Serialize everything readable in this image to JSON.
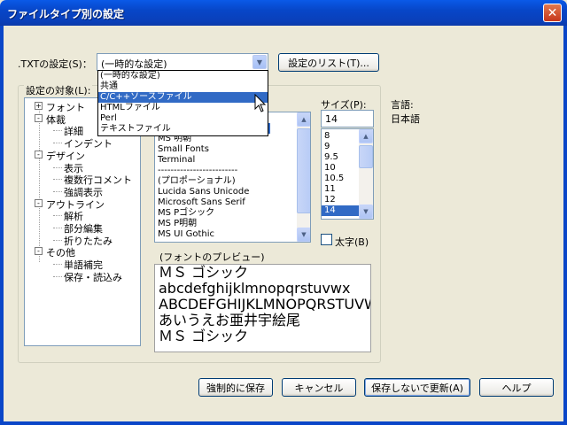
{
  "window": {
    "title": "ファイルタイプ別の設定",
    "close_label": "✕"
  },
  "settings_of": {
    "label": ".TXTの設定(S)：",
    "selected": "(一時的な設定)",
    "list_button": "設定のリスト(T)...",
    "options": [
      "(一時的な設定)",
      "共通",
      "C/C++ソースファイル",
      "HTMLファイル",
      "Perl",
      "テキストファイル"
    ],
    "selected_option": "C/C++ソースファイル"
  },
  "target": {
    "label": "設定の対象(L):",
    "tree": [
      {
        "label": "フォント",
        "toggle": "+"
      },
      {
        "label": "体裁",
        "toggle": "-"
      },
      {
        "label": "詳細"
      },
      {
        "label": "インデント"
      },
      {
        "label": "デザイン",
        "toggle": "-"
      },
      {
        "label": "表示"
      },
      {
        "label": "複数行コメント"
      },
      {
        "label": "強調表示"
      },
      {
        "label": "アウトライン",
        "toggle": "-"
      },
      {
        "label": "解析"
      },
      {
        "label": "部分編集"
      },
      {
        "label": "折りたたみ"
      },
      {
        "label": "その他",
        "toggle": "-"
      },
      {
        "label": "単語補完"
      },
      {
        "label": "保存・読込み"
      }
    ]
  },
  "font_list": {
    "items": [
      "MS 明朝",
      "Small Fonts",
      "Terminal",
      "-------------------------",
      "(プロポーショナル)",
      "Lucida Sans Unicode",
      "Microsoft Sans Serif",
      "MS Pゴシック",
      "MS P明朝",
      "MS UI Gothic"
    ]
  },
  "size": {
    "label": "サイズ(P):",
    "value": "14",
    "items": [
      "8",
      "9",
      "9.5",
      "10",
      "10.5",
      "11",
      "12",
      "14"
    ],
    "selected": "14"
  },
  "language": {
    "label": "言語:",
    "value": "日本語"
  },
  "bold": {
    "label": "太字(B)",
    "checked": false
  },
  "preview": {
    "label": "(フォントのプレビュー)",
    "lines": [
      "ＭＳ ゴシック",
      "abcdefghijklmnopqrstuvwx",
      "ABCDEFGHIJKLMNOPQRSTUVWX",
      "あいうえお亜井宇絵尾",
      "ＭＳ ゴシック"
    ]
  },
  "buttons": {
    "force_save": "強制的に保存",
    "cancel": "キャンセル",
    "update_no_save": "保存しないで更新(A)",
    "help": "ヘルプ"
  },
  "colors": {
    "title_blue": "#0746c8",
    "selection": "#316ac5",
    "face": "#ece9d8"
  }
}
